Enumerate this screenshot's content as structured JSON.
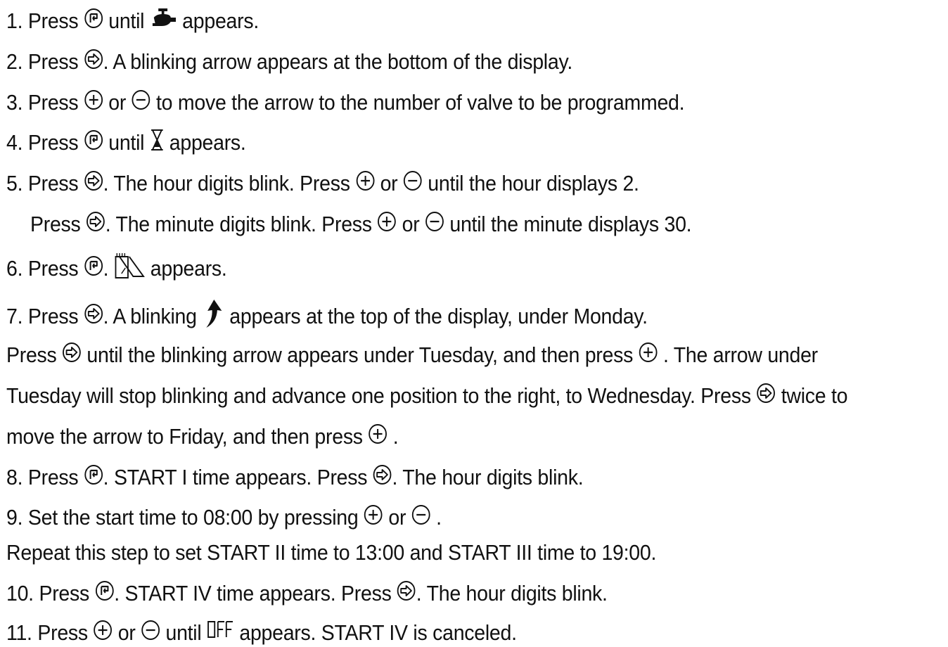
{
  "steps": [
    {
      "id": "s1",
      "parts": [
        "1. Press ",
        " until ",
        " appears."
      ]
    },
    {
      "id": "s2",
      "parts": [
        "2. Press ",
        ". A blinking arrow appears at the bottom of the display."
      ]
    },
    {
      "id": "s3",
      "parts": [
        "3. Press ",
        " or ",
        " to move the arrow to the number of valve to be programmed."
      ]
    },
    {
      "id": "s4",
      "parts": [
        "4. Press ",
        " until ",
        " appears."
      ]
    },
    {
      "id": "s5a",
      "parts": [
        "5. Press ",
        ". The hour digits blink. Press ",
        " or ",
        "  until the hour displays 2."
      ]
    },
    {
      "id": "s5b",
      "parts": [
        "Press ",
        ". The minute digits blink. Press ",
        " or ",
        "  until the minute displays 30."
      ]
    },
    {
      "id": "s6",
      "parts": [
        "6. Press ",
        ".  ",
        " appears."
      ]
    },
    {
      "id": "s7a",
      "parts": [
        "7. Press ",
        ". A blinking ",
        " appears at the top of the display, under Monday."
      ]
    },
    {
      "id": "s7b",
      "parts": [
        "Press ",
        " until the blinking arrow appears under Tuesday, and then press ",
        " . The arrow under"
      ]
    },
    {
      "id": "s7c",
      "parts": [
        "Tuesday will stop blinking and advance one position to the right, to Wednesday. Press ",
        " twice to"
      ]
    },
    {
      "id": "s7d",
      "parts": [
        "move the arrow to Friday, and then press ",
        " ."
      ]
    },
    {
      "id": "s8",
      "parts": [
        "8. Press ",
        ". START I time appears. Press ",
        ". The hour digits blink."
      ]
    },
    {
      "id": "s9a",
      "parts": [
        "9. Set the start time to 08:00 by pressing  ",
        " or ",
        " ."
      ]
    },
    {
      "id": "s9b",
      "parts": [
        "Repeat this step to set START II time to 13:00 and START III time  to 19:00."
      ]
    },
    {
      "id": "s10",
      "parts": [
        "10. Press ",
        ". START IV time appears. Press ",
        ". The hour digits blink."
      ]
    },
    {
      "id": "s11",
      "parts": [
        "11. Press  ",
        " or ",
        "  until ",
        " appears. START IV is canceled."
      ]
    }
  ],
  "display_text": {
    "off": "OFF"
  },
  "icons": {
    "cycle": "cycle-button-icon",
    "next": "next-arrow-button-icon",
    "plus": "plus-button-icon",
    "minus": "minus-button-icon",
    "faucet": "faucet-icon",
    "hourglass": "hourglass-icon",
    "calendar": "calendar-icon",
    "up_arrow": "up-arrow-icon"
  }
}
